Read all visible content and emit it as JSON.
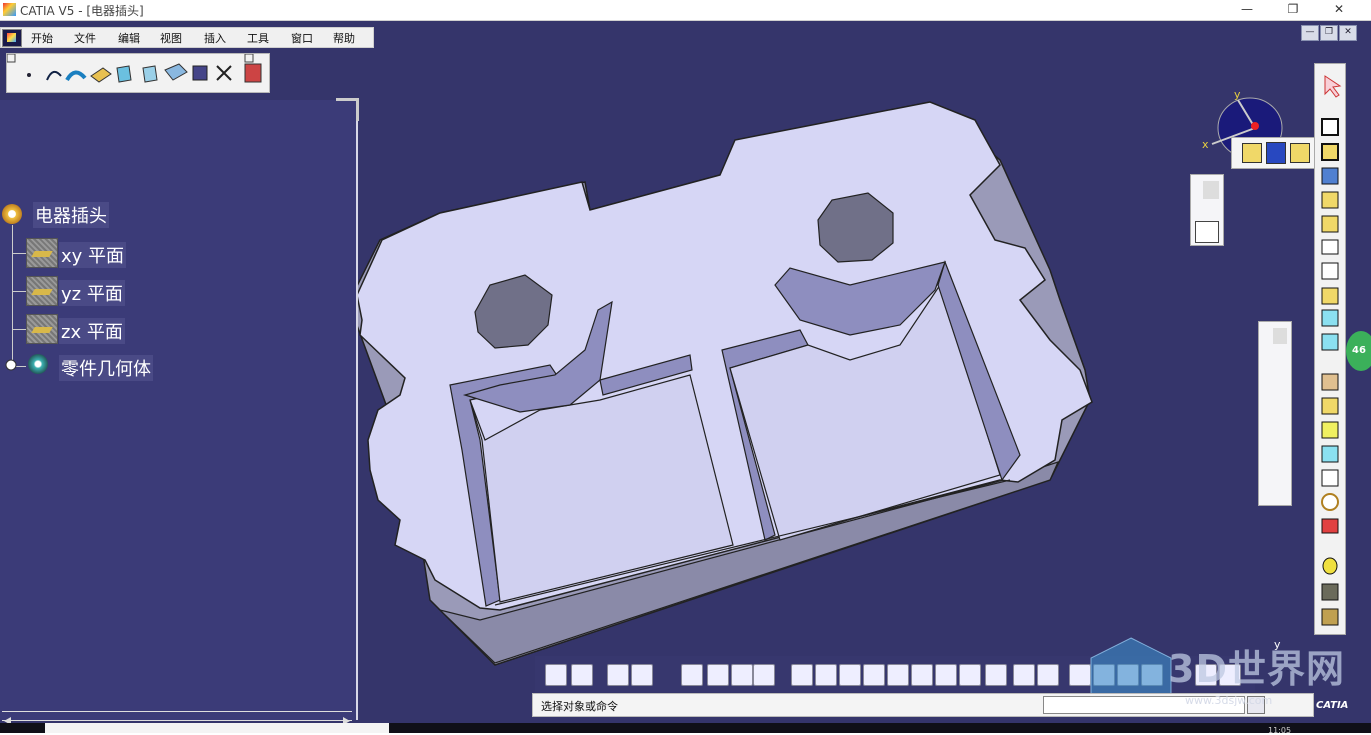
{
  "window": {
    "title": "CATIA V5 - [电器插头]",
    "min_label": "—",
    "max_label": "❐",
    "close_label": "✕"
  },
  "menu": {
    "items": [
      "开始",
      "文件",
      "编辑",
      "视图",
      "插入",
      "工具",
      "窗口",
      "帮助"
    ]
  },
  "mdi": {
    "min": "—",
    "restore": "❐",
    "close": "✕"
  },
  "tree": {
    "root": "电器插头",
    "planes": [
      "xy 平面",
      "yz 平面",
      "zx 平面"
    ],
    "body": "零件几何体"
  },
  "compass": {
    "x_label": "x",
    "y_label": "y"
  },
  "axis_small": {
    "y_label": "y"
  },
  "status": {
    "prompt": "选择对象或命令"
  },
  "badge": {
    "count": "46"
  },
  "watermark": {
    "text": "3D世界网",
    "url": "www.3dsjw.com"
  },
  "logo": {
    "brand": "CATIA"
  },
  "clock": {
    "time": "11:05"
  },
  "colors": {
    "workspace": "#35356b",
    "tree_panel": "#3b3b78",
    "part_face": "#d6d6f5",
    "part_side": "#9a9ab8",
    "part_shadow": "#6d6d88"
  }
}
